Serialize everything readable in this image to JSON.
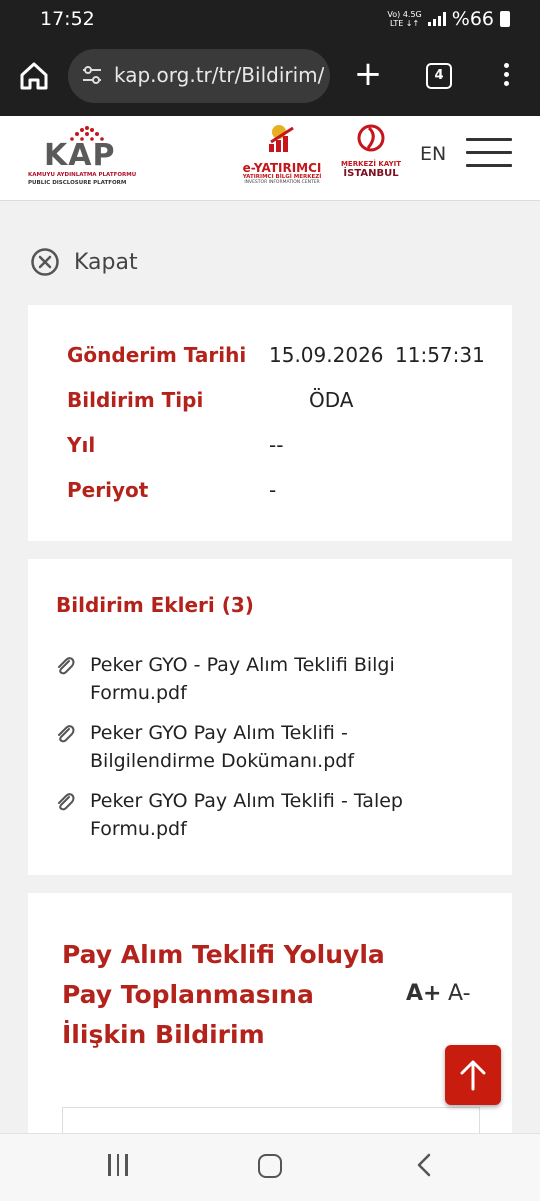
{
  "status": {
    "time": "17:52",
    "net_top": "Vo) 4.5G",
    "net_bottom": "LTE ↓↑",
    "battery": "%66"
  },
  "browser": {
    "url": "kap.org.tr/tr/Bildirim/",
    "tab_count": "4"
  },
  "header": {
    "kap_name": "KAP",
    "kap_sub1": "KAMUYU AYDINLATMA PLATFORMU",
    "kap_sub2": "PUBLIC DISCLOSURE PLATFORM",
    "ey_title": "e-YATIRIMCI",
    "ey_sub1": "YATIRIMCI BİLGİ MERKEZİ",
    "ey_sub2": "INVESTOR INFORMATION CENTER",
    "mk_title1": "MERKEZİ KAYIT",
    "mk_title2": "İSTANBUL",
    "lang": "EN"
  },
  "close_label": "Kapat",
  "info": {
    "rows": [
      {
        "label": "Gönderim Tarihi",
        "value": "15.09.2026",
        "time": "11:57:31"
      },
      {
        "label": "Bildirim Tipi",
        "value": "ÖDA"
      },
      {
        "label": "Yıl",
        "value": "--"
      },
      {
        "label": "Periyot",
        "value": "-"
      }
    ]
  },
  "attachments": {
    "title": "Bildirim Ekleri (3)",
    "items": [
      "Peker GYO - Pay Alım Teklifi Bilgi Formu.pdf",
      "Peker GYO Pay Alım Teklifi - Bilgilendirme Dokümanı.pdf",
      "Peker GYO Pay Alım Teklifi - Talep Formu.pdf"
    ]
  },
  "announcement": {
    "title": "Pay Alım Teklifi Yoluyla Pay Toplanmasına İlişkin Bildirim",
    "font_increase": "A+",
    "font_decrease": "A-"
  },
  "colors": {
    "accent": "#b3231c",
    "scroll_button": "#c81d0e",
    "browser_bar": "#1f1f1f"
  }
}
